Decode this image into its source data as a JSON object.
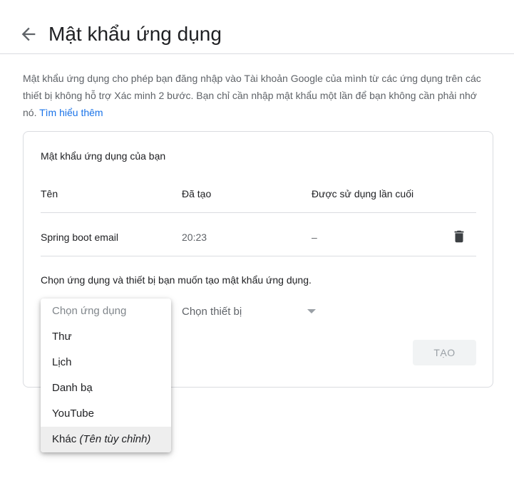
{
  "header": {
    "back_icon": "arrow-back-icon",
    "title": "Mật khẩu ứng dụng"
  },
  "description": {
    "text": "Mật khẩu ứng dụng cho phép bạn đăng nhập vào Tài khoản Google của mình từ các ứng dụng trên các thiết bị không hỗ trợ Xác minh 2 bước. Bạn chỉ cần nhập mật khẩu một lần để bạn không cần phải nhớ nó.",
    "link_label": "Tìm hiểu thêm",
    "link_color": "#1a73e8"
  },
  "card": {
    "title": "Mật khẩu ứng dụng của bạn",
    "columns": [
      "Tên",
      "Đã tạo",
      "Được sử dụng lần cuối"
    ],
    "rows": [
      {
        "name": "Spring boot email",
        "created": "20:23",
        "last_used": "–",
        "action_icon": "trash-icon"
      }
    ],
    "select_prompt": "Chọn ứng dụng và thiết bị bạn muốn tạo mật khẩu ứng dụng.",
    "device_select": {
      "label": "Chọn thiết bị",
      "icon": "dropdown-arrow-icon"
    },
    "create_button": "TẠO"
  },
  "app_dropdown": {
    "placeholder": "Chọn ứng dụng",
    "options": [
      "Thư",
      "Lịch",
      "Danh bạ",
      "YouTube"
    ],
    "custom_option": {
      "label": "Khác",
      "hint": "(Tên tùy chỉnh)"
    }
  }
}
